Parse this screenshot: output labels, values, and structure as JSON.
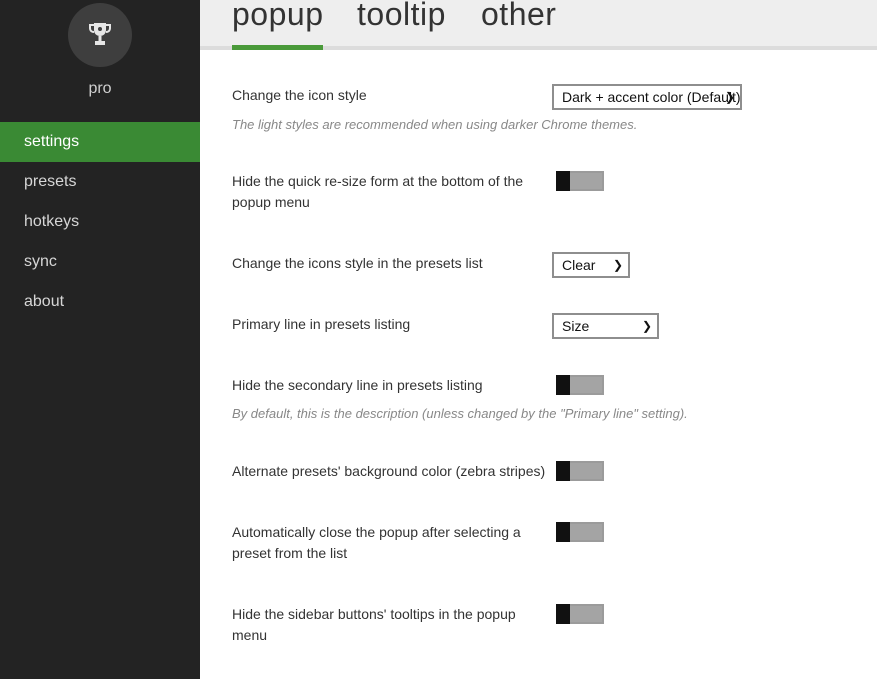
{
  "sidebar": {
    "avatar_icon": "trophy-icon",
    "pro_label": "pro",
    "items": [
      {
        "label": "settings",
        "active": true
      },
      {
        "label": "presets"
      },
      {
        "label": "hotkeys"
      },
      {
        "label": "sync"
      },
      {
        "label": "about"
      }
    ]
  },
  "tabs": [
    {
      "label": "popup",
      "active": true
    },
    {
      "label": "tooltip"
    },
    {
      "label": "other"
    }
  ],
  "settings": {
    "icon_style": {
      "label": "Change the icon style",
      "value": "Dark + accent color (Default)",
      "hint": "The light styles are recommended when using darker Chrome themes."
    },
    "hide_resize": {
      "label": "Hide the quick re-size form at the bottom of the popup menu",
      "on": false
    },
    "presets_icons_style": {
      "label": "Change the icons style in the presets list",
      "value": "Clear"
    },
    "primary_line": {
      "label": "Primary line in presets listing",
      "value": "Size"
    },
    "hide_secondary": {
      "label": "Hide the secondary line in presets listing",
      "hint": "By default, this is the description (unless changed by the \"Primary line\" setting).",
      "on": false
    },
    "zebra": {
      "label": "Alternate presets' background color (zebra stripes)",
      "on": false
    },
    "auto_close": {
      "label": "Automatically close the popup after selecting a preset from the list",
      "on": false
    },
    "hide_tooltips": {
      "label": "Hide the sidebar buttons' tooltips in the popup menu",
      "on": false
    }
  },
  "colors": {
    "accent": "#3a8a34",
    "sidebar_bg": "#232323"
  }
}
